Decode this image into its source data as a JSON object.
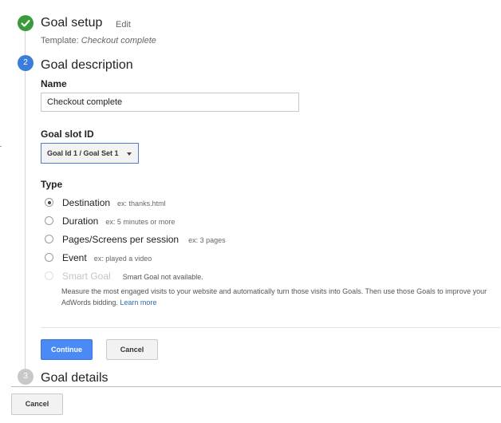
{
  "step1": {
    "number": "1",
    "title": "Goal setup",
    "edit_label": "Edit",
    "template_prefix": "Template: ",
    "template_value": "Checkout complete"
  },
  "step2": {
    "number": "2",
    "title": "Goal description",
    "name_label": "Name",
    "name_value": "Checkout complete",
    "slot_label": "Goal slot ID",
    "slot_value": "Goal Id 1 / Goal Set 1",
    "type_label": "Type",
    "options": [
      {
        "label": "Destination",
        "example": "ex: thanks.html",
        "checked": true
      },
      {
        "label": "Duration",
        "example": "ex: 5 minutes or more",
        "checked": false
      },
      {
        "label": "Pages/Screens per session",
        "example": "ex: 3 pages",
        "checked": false
      },
      {
        "label": "Event",
        "example": "ex: played a video",
        "checked": false
      },
      {
        "label": "Smart Goal",
        "example": "Smart Goal not available.",
        "checked": false,
        "disabled": true
      }
    ],
    "smart_desc": "Measure the most engaged visits to your website and automatically turn those visits into Goals. Then use those Goals to improve your AdWords bidding.",
    "learn_more": "Learn more",
    "continue_label": "Continue",
    "cancel_label": "Cancel"
  },
  "step3": {
    "number": "3",
    "title": "Goal details"
  },
  "footer": {
    "cancel_label": "Cancel"
  },
  "colors": {
    "done_green": "#3a9b3a",
    "active_blue": "#3b7dd8",
    "inactive_gray": "#c8c8c8",
    "link_blue": "#2b6cb0",
    "primary_button": "#4a8af4"
  }
}
